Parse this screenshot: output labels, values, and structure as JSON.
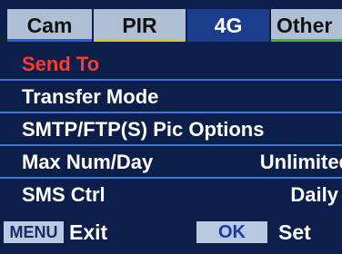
{
  "tabs": [
    {
      "label": "Cam"
    },
    {
      "label": "PIR"
    },
    {
      "label": "4G"
    },
    {
      "label": "Other"
    }
  ],
  "active_tab": "4G",
  "menu": {
    "items": [
      {
        "label": "Send To",
        "value": ""
      },
      {
        "label": "Transfer Mode",
        "value": ""
      },
      {
        "label": "SMTP/FTP(S) Pic Options",
        "value": ""
      },
      {
        "label": "Max Num/Day",
        "value": "Unlimited"
      },
      {
        "label": "SMS Ctrl",
        "value": "Daily"
      }
    ],
    "selected_item": "Send To"
  },
  "footer": {
    "menu_key": "MENU",
    "menu_action": "Exit",
    "ok_key": "OK",
    "ok_action": "Set"
  },
  "colors": {
    "background": "#0b1f4a",
    "selected_text": "#ff3b2b",
    "active_tab": "#1c3d8c",
    "inactive_tab": "#aebfd6",
    "divider": "#3a78d6",
    "cam_underline": "#2b5bd8",
    "pir_underline": "#e2c21a",
    "other_underline": "#3fb43a"
  }
}
